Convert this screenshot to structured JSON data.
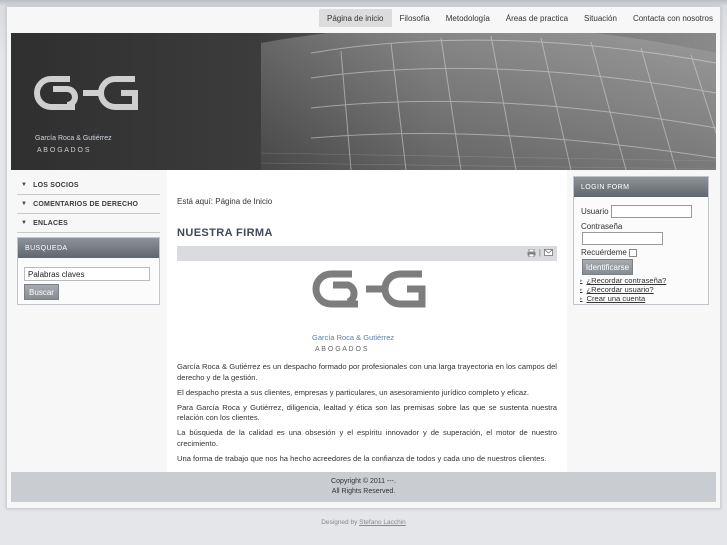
{
  "nav": {
    "items": [
      {
        "label": "Página de inicio",
        "active": true
      },
      {
        "label": "Filosofía",
        "active": false
      },
      {
        "label": "Metodología",
        "active": false
      },
      {
        "label": "Áreas de practica",
        "active": false
      },
      {
        "label": "Situación",
        "active": false
      },
      {
        "label": "Contacta con nosotros",
        "active": false
      }
    ]
  },
  "brand": {
    "monogram": "GG",
    "name": "García Roca & Gutiérrez",
    "subtitle": "A B O G A D O S",
    "accent_color": "#5b7fb1"
  },
  "sidebar": {
    "menu": [
      {
        "label": "Los socios"
      },
      {
        "label": "Comentarios de derecho"
      },
      {
        "label": "Enlaces"
      }
    ],
    "search": {
      "title": "Busqueda",
      "input_value": "Palabras claves",
      "button": "Buscar"
    }
  },
  "main": {
    "breadcrumb": "Está aquí: Página de Inicio",
    "title": "Nuestra Firma",
    "toolbar_icons": [
      "print-icon",
      "email-icon"
    ],
    "paragraphs": [
      "García Roca & Gutiérrez es un despacho formado por profesionales con una larga trayectoria en los campos del derecho y de la gestión.",
      "El despacho presta a sus clientes, empresas y particulares, un asesoramiento jurídico completo y eficaz.",
      "Para García Roca y Gutiérrez, diligencia, lealtad y ética son las premisas sobre las que se sustenta nuestra relación con los clientes.",
      "La búsqueda de la calidad es una obsesión y el espíritu innovador y de superación, el motor de nuestro crecimiento.",
      "Una forma de trabajo que nos ha hecho acreedores de la confianza de todos y cada uno de nuestros clientes."
    ]
  },
  "login": {
    "title": "Login Form",
    "username_label": "Usuario",
    "password_label": "Contraseña",
    "remember_label": "Recuérdeme",
    "button": "Identificarse",
    "links": [
      "¿Recordar contraseña?",
      "¿Recordar usuario?",
      "Crear una cuenta"
    ]
  },
  "footer": {
    "line1": "Copyright © 2011 ---.",
    "line2": "All Rights Reserved.",
    "credit_prefix": "Designed by",
    "credit_name": "Stefano Lacchin"
  }
}
